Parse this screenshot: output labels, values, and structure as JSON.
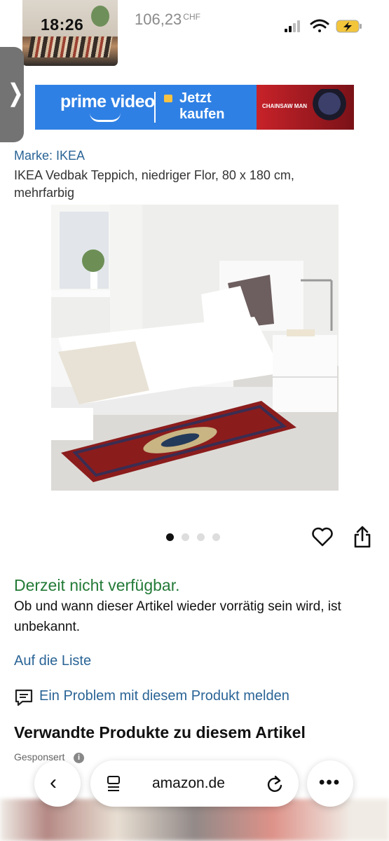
{
  "status_bar": {
    "time": "18:26",
    "price_value": "106,23",
    "price_currency": "CHF"
  },
  "banner": {
    "brand_text": "prime video",
    "cta_line1": "Jetzt",
    "cta_line2": "kaufen",
    "promo_title": "CHAINSAW MAN"
  },
  "product": {
    "brand": "Marke: IKEA",
    "title": "IKEA Vedbak Teppich, niedriger Flor, 80 x 180 cm, mehrfarbig"
  },
  "gallery": {
    "image_count": 4,
    "active_index": 0
  },
  "availability": {
    "status": "Derzeit nicht verfügbar.",
    "description": "Ob und wann dieser Artikel wieder vorrätig sein wird, ist unbekannt."
  },
  "links": {
    "wishlist": "Auf die Liste",
    "report": "Ein Problem mit diesem Produkt melden"
  },
  "related": {
    "heading": "Verwandte Produkte zu diesem Artikel",
    "sponsored": "Gesponsert"
  },
  "browser": {
    "url": "amazon.de"
  },
  "colors": {
    "link": "#2a6496",
    "available_status": "#237a37",
    "prime_blue": "#2f80e4"
  }
}
